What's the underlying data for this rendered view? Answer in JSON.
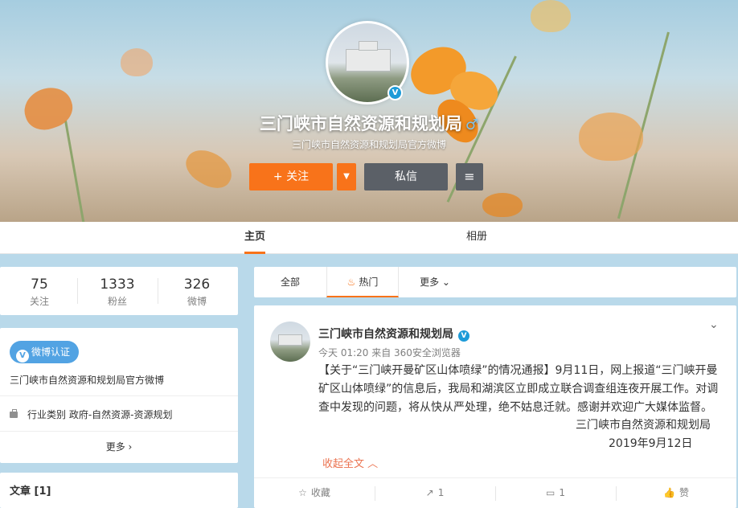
{
  "profile": {
    "name": "三门峡市自然资源和规划局",
    "gender_symbol": "♂",
    "intro": "三门峡市自然资源和规划局官方微博",
    "follow_label": "+ 关注",
    "dropdown_glyph": "▼",
    "message_label": "私信",
    "menu_glyph": "≡",
    "verified_glyph": "V"
  },
  "nav": {
    "home": "主页",
    "album": "相册"
  },
  "stats": [
    {
      "value": "75",
      "label": "关注"
    },
    {
      "value": "1333",
      "label": "粉丝"
    },
    {
      "value": "326",
      "label": "微博"
    }
  ],
  "info": {
    "badge_label": "微博认证",
    "badge_v": "V",
    "description": "三门峡市自然资源和规划局官方微博",
    "industry": "行业类别 政府-自然资源-资源规划",
    "more_label": "更多 ›"
  },
  "articles": {
    "title": "文章 [1]"
  },
  "feed_tabs": {
    "all": "全部",
    "hot": "热门",
    "more": "更多 ⌄",
    "fire_glyph": "♨"
  },
  "post": {
    "author": "三门峡市自然资源和规划局",
    "author_v": "V",
    "meta": "今天 01:20 来自 360安全浏览器",
    "chevron": "⌄",
    "text": "【关于“三门峡开曼矿区山体喷绿”的情况通报】9月11日，网上报道“三门峡开曼矿区山体喷绿”的信息后，我局和湖滨区立即成立联合调查组连夜开展工作。对调查中发现的问题，将从快从严处理，绝不姑息迁就。感谢并欢迎广大媒体监督。",
    "sign_org": "三门峡市自然资源和规划局",
    "sign_date": "2019年9月12日",
    "collapse_label": "收起全文 ︿",
    "actions": [
      {
        "icon": "☆",
        "label": "收藏"
      },
      {
        "icon": "↗",
        "label": "1"
      },
      {
        "icon": "▭",
        "label": "1"
      },
      {
        "icon": "👍",
        "label": "赞"
      }
    ]
  },
  "colors": {
    "accent": "#f8731a",
    "verified_blue": "#1d9bd8",
    "dark_button": "#5b6067",
    "page_bg": "#b9d9ea"
  }
}
